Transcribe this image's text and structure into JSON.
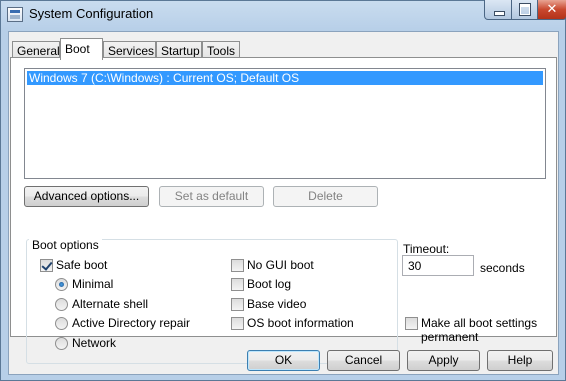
{
  "window": {
    "title": "System Configuration",
    "close_glyph": "✕"
  },
  "tabs": [
    {
      "label": "General",
      "active": false
    },
    {
      "label": "Boot",
      "active": true
    },
    {
      "label": "Services",
      "active": false
    },
    {
      "label": "Startup",
      "active": false
    },
    {
      "label": "Tools",
      "active": false
    }
  ],
  "os_list": {
    "items": [
      "Windows 7 (C:\\Windows) : Current OS; Default OS"
    ]
  },
  "actions": {
    "advanced_options": "Advanced options...",
    "set_as_default": "Set as default",
    "delete": "Delete"
  },
  "boot_options": {
    "label": "Boot options",
    "safe_boot": {
      "label": "Safe boot",
      "checked": true
    },
    "modes": [
      {
        "label": "Minimal",
        "checked": true
      },
      {
        "label": "Alternate shell",
        "checked": false
      },
      {
        "label": "Active Directory repair",
        "checked": false
      },
      {
        "label": "Network",
        "checked": false
      }
    ],
    "extra": [
      {
        "label": "No GUI boot",
        "checked": false
      },
      {
        "label": "Boot log",
        "checked": false
      },
      {
        "label": "Base video",
        "checked": false
      },
      {
        "label": "OS boot information",
        "checked": false
      }
    ]
  },
  "timeout": {
    "label": "Timeout:",
    "value": "30",
    "unit": "seconds"
  },
  "make_permanent": {
    "label_line1": "Make all boot settings",
    "label_line2": "permanent",
    "checked": false
  },
  "buttons": {
    "ok": "OK",
    "cancel": "Cancel",
    "apply": "Apply",
    "help": "Help"
  },
  "colors": {
    "selection": "#3399ff",
    "title_bar": "#b7cfe8",
    "close_button": "#c9482e"
  },
  "icons": {
    "title": "system-config-icon",
    "minimize": "minimize-icon",
    "maximize": "maximize-icon",
    "close": "close-icon"
  }
}
